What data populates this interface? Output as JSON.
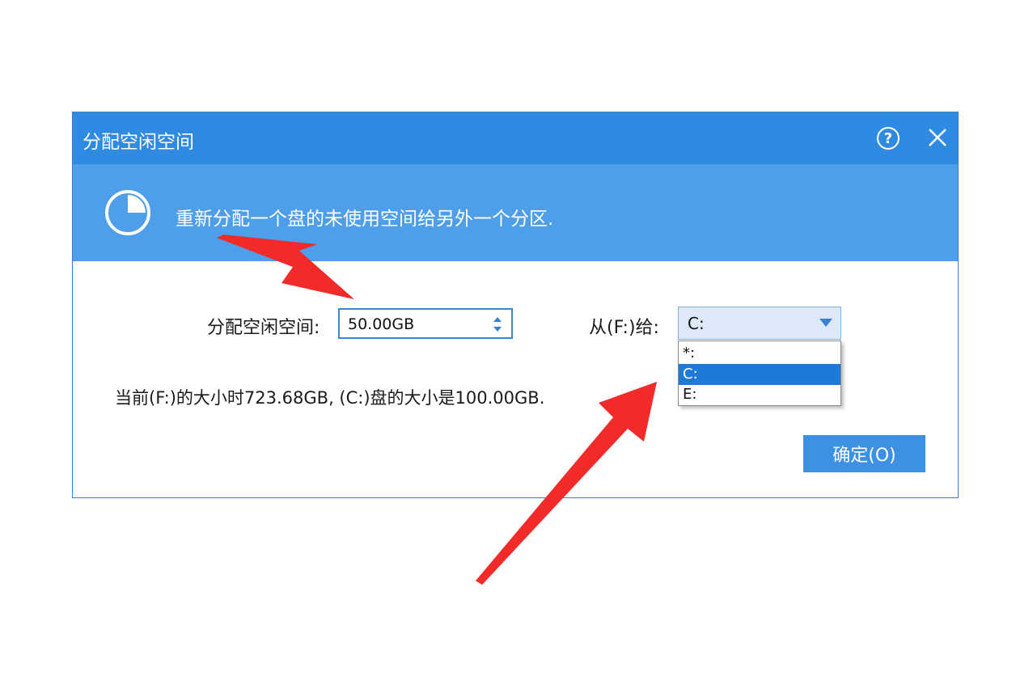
{
  "dialog": {
    "title": "分配空闲空间",
    "banner_text": "重新分配一个盘的未使用空间给另外一个分区.",
    "size_label": "分配空闲空间:",
    "size_value": "50.00GB",
    "from_label": "从(F:)给:",
    "selected_drive": "C:",
    "drive_options": [
      "*:",
      "C:",
      "E:"
    ],
    "info_text": "当前(F:)的大小时723.68GB, (C:)盘的大小是100.00GB.",
    "ok_label": "确定(O)"
  },
  "icons": {
    "help": "help-icon",
    "close": "close-icon",
    "banner": "pie-chart-icon",
    "spinner": "spin-arrows-icon",
    "dropdown": "chevron-down-icon"
  },
  "colors": {
    "titlebar": "#2f8be2",
    "banner": "#4f9ee9",
    "button": "#3e90e3",
    "selection": "#1e7ad6",
    "annotation_arrow": "#f22a2a"
  }
}
